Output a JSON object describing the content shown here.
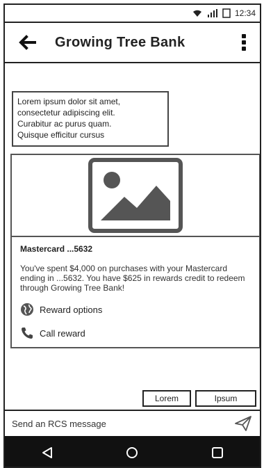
{
  "status_bar": {
    "time": "12:34",
    "icons": [
      "wifi-icon",
      "signal-icon",
      "battery-icon"
    ]
  },
  "app_bar": {
    "title": "Growing Tree Bank",
    "back_icon": "arrow-left-icon",
    "menu_icon": "more-vertical-icon"
  },
  "message": {
    "text_lines": [
      "Lorem ipsum dolor sit amet,",
      "consectetur adipiscing elit.",
      "Curabitur ac purus quam.",
      "Quisque efficitur cursus"
    ]
  },
  "rich_card": {
    "media_icon": "image-placeholder-icon",
    "title": "Mastercard ...5632",
    "description": "You've spent $4,000 on purchases with your Mastercard ending in ...5632. You have $625 in rewards credit to redeem through Growing Tree Bank!",
    "actions": [
      {
        "label": "Reward options",
        "icon": "globe-icon"
      },
      {
        "label": "Call reward",
        "icon": "phone-icon"
      }
    ]
  },
  "suggestions": [
    {
      "label": "Lorem"
    },
    {
      "label": "Ipsum"
    }
  ],
  "composer": {
    "placeholder": "Send an RCS message",
    "send_icon": "send-icon"
  },
  "nav_bar": {
    "icons": [
      "back-triangle-icon",
      "home-circle-icon",
      "recents-square-icon"
    ]
  },
  "colors": {
    "frame": "#222222",
    "nav_background": "#111111",
    "media_icon": "#555555"
  }
}
